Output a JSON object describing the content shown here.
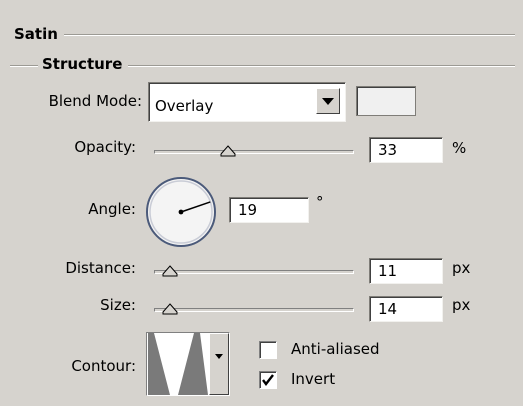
{
  "panel": {
    "title": "Satin",
    "section_title": "Structure"
  },
  "blend_mode": {
    "label": "Blend Mode:",
    "value": "Overlay",
    "color_swatch": "#f0f0f0"
  },
  "opacity": {
    "label": "Opacity:",
    "value": "33",
    "unit": "%",
    "slider_fraction": 0.33
  },
  "angle": {
    "label": "Angle:",
    "value": "19",
    "unit": "°",
    "degrees": 19
  },
  "distance": {
    "label": "Distance:",
    "value": "11",
    "unit": "px",
    "slider_fraction": 0.04
  },
  "size": {
    "label": "Size:",
    "value": "14",
    "unit": "px",
    "slider_fraction": 0.04
  },
  "contour": {
    "label": "Contour:",
    "anti_aliased_label": "Anti-aliased",
    "anti_aliased_checked": false,
    "invert_label": "Invert",
    "invert_checked": true
  }
}
